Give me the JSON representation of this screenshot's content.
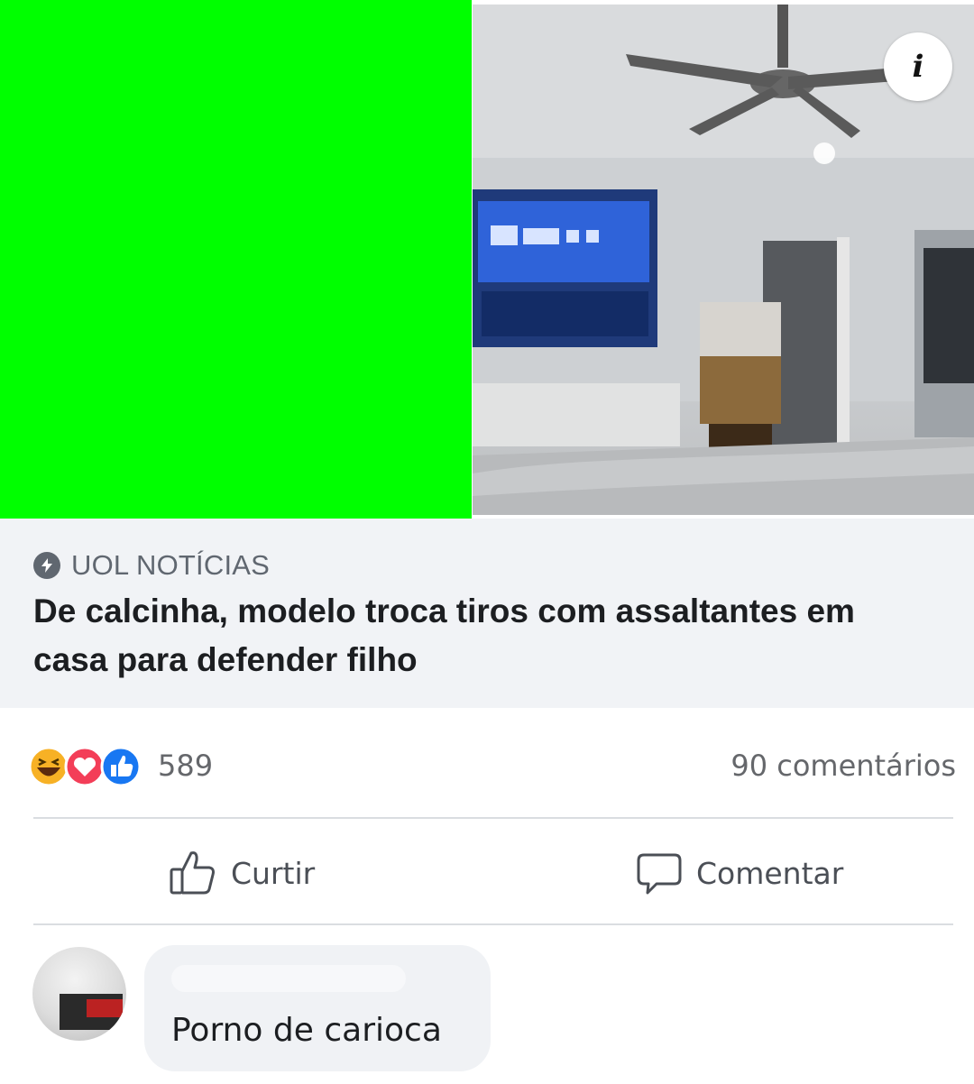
{
  "post": {
    "source": "UOL NOTÍCIAS",
    "headline": "De calcinha, modelo troca tiros com assaltantes em casa para defender filho",
    "info_icon_glyph": "i",
    "media_icon": "info-icon"
  },
  "reactions": {
    "icons": [
      "haha-icon",
      "love-icon",
      "like-icon"
    ],
    "count": "589",
    "comments": "90 comentários"
  },
  "actions": {
    "like_label": "Curtir",
    "comment_label": "Comentar"
  },
  "comment": {
    "text": "Porno de carioca"
  },
  "colors": {
    "green_block": "#00ff00",
    "preview_bg": "#f1f3f6",
    "like_blue": "#1877f2",
    "love_red": "#f33e58",
    "haha_yellow": "#f7b125"
  }
}
